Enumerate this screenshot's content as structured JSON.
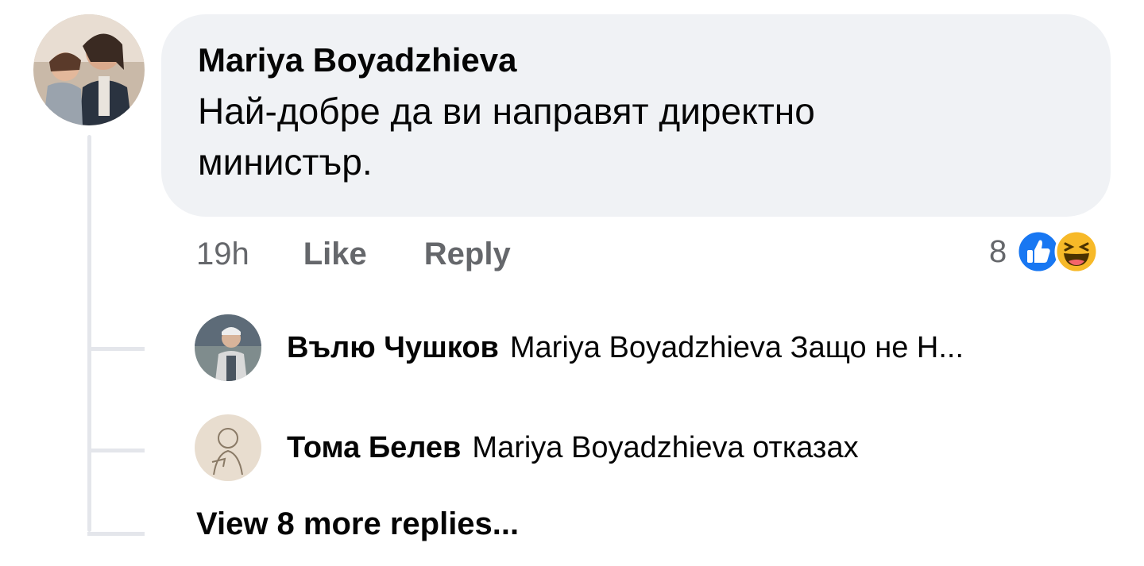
{
  "comment": {
    "author": "Mariya Boyadzhieva",
    "text": "Най-добре да ви направят директно министър.",
    "timestamp": "19h",
    "like_label": "Like",
    "reply_label": "Reply",
    "reaction_count": "8",
    "reactions": [
      "like-icon",
      "haha-icon"
    ]
  },
  "replies": [
    {
      "author": "Вълю Чушков",
      "text": "Mariya Boyadzhieva Защо не Н..."
    },
    {
      "author": "Тома Белев",
      "text": "Mariya Boyadzhieva отказах"
    }
  ],
  "view_more_label": "View 8 more replies...",
  "colors": {
    "bubble": "#f0f2f5",
    "meta_text": "#65676b",
    "like_blue": "#1877f2",
    "haha_yellow": "#f7b928",
    "thread_line": "#e4e6eb"
  }
}
